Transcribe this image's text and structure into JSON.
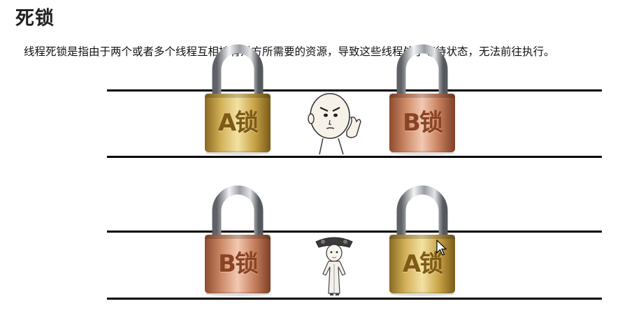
{
  "title": "死锁",
  "description": "线程死锁是指由于两个或者多个线程互相持有对方所需要的资源，导致这些线程处于等待状态，无法前往执行。",
  "rows": [
    {
      "left_lock": {
        "label": "A锁",
        "finish": "gold"
      },
      "figure": "bald-man-figure",
      "right_lock": {
        "label": "B锁",
        "finish": "copper"
      }
    },
    {
      "left_lock": {
        "label": "B锁",
        "finish": "copper"
      },
      "figure": "qing-lady-figure",
      "right_lock": {
        "label": "A锁",
        "finish": "gold"
      }
    }
  ],
  "colors": {
    "gold": "#c9a448",
    "copper": "#c7805f",
    "line": "#000000",
    "shackle": "#b5b8bc"
  },
  "icons": [
    "padlock-icon",
    "cursor-arrow-icon"
  ]
}
